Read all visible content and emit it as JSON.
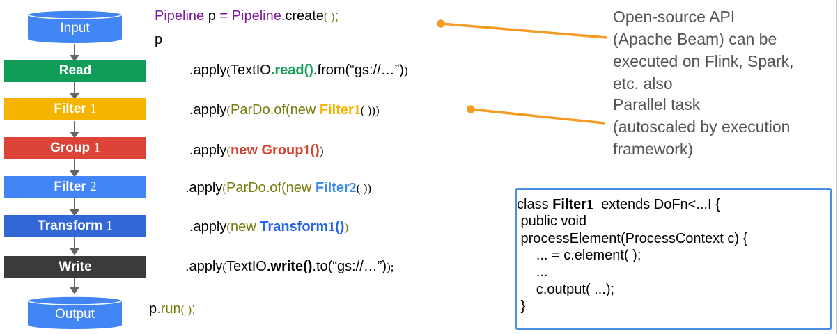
{
  "pipeline": {
    "input_label": "Input",
    "output_label": "Output",
    "stages": [
      {
        "name": "Read",
        "num": "",
        "color": "#0f9d58"
      },
      {
        "name": "Filter",
        "num": "1",
        "color": "#f4b400"
      },
      {
        "name": "Group",
        "num": "1",
        "color": "#db4437"
      },
      {
        "name": "Filter",
        "num": "2",
        "color": "#4285f4"
      },
      {
        "name": "Transform",
        "num": "1",
        "color": "#3367d6"
      },
      {
        "name": "Write",
        "num": "",
        "color": "#3b3b3b"
      }
    ],
    "cylinder_color": "#4285f4",
    "arrow_color": "#666666"
  },
  "code": {
    "line1": {
      "t1": "Pipeline",
      "t2": " p ",
      "t3": "=",
      "t4": " Pipeline",
      "t5": ".",
      "t6": "create",
      "t7": "( )",
      "t8": ";"
    },
    "line2": "p",
    "read": {
      "a": ".apply",
      "b": "(",
      "c": "TextIO",
      "d": ".read()",
      "e": ".from",
      "f": "(“gs://…”)",
      "g": ")"
    },
    "filter1": {
      "a": ".apply",
      "b": "(",
      "c": "ParDo.of",
      "d": "(new ",
      "e": "Filter",
      "n": "1",
      "f": "( )",
      "g": "))"
    },
    "group1": {
      "a": ".apply",
      "b": "(",
      "c": "new Group",
      "n": "1",
      "d": "()",
      "e": ")"
    },
    "filter2": {
      "a": ".apply",
      "b": "(",
      "c": "ParDo.of",
      "d": "(new ",
      "e": "Filter",
      "n": "2",
      "f": "( )",
      "g": ")"
    },
    "transform1": {
      "a": ".apply",
      "b": "(",
      "c": "new ",
      "d": "Transform",
      "n": "1",
      "e": "()",
      "f": ")"
    },
    "write": {
      "a": ".apply",
      "b": "(",
      "c": "TextIO",
      "d": ".write()",
      "e": ".to",
      "f": "(“gs://…”)",
      "g": ");"
    },
    "run": {
      "a": "p",
      "b": ".run",
      "c": "( )",
      "d": ";"
    }
  },
  "notes": {
    "beam": "Open-source API\n(Apache Beam) can be\nexecuted on Flink, Spark,\netc. also",
    "parallel": "Parallel task\n(autoscaled by execution\nframework)",
    "line_color": "#f59a23"
  },
  "class_box": {
    "l1a": "class ",
    "l1b": "Filter",
    "l1c": "1",
    "l1d": "  extends DoFn<...I {",
    "l2": " public void",
    "l3": " processElement(ProcessContext c) {",
    "l4": "     ... = c.element( );",
    "l5": "     ...",
    "l6": "     c.output( ...);",
    "l7": " }"
  }
}
